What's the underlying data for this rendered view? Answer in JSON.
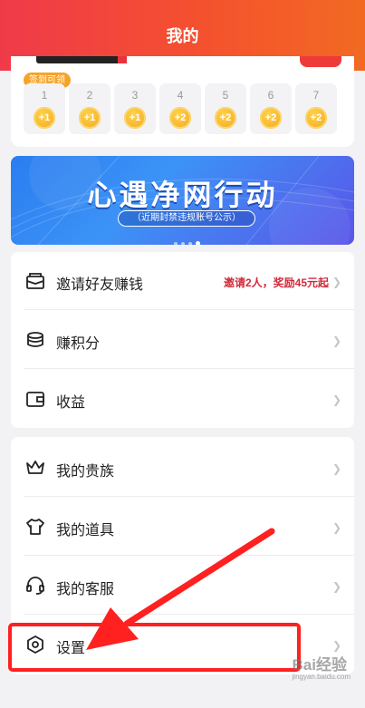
{
  "header": {
    "title": "我的"
  },
  "signin": {
    "badge": "签到可领",
    "days": [
      {
        "day": "1",
        "reward": "+1"
      },
      {
        "day": "2",
        "reward": "+1"
      },
      {
        "day": "3",
        "reward": "+1"
      },
      {
        "day": "4",
        "reward": "+2"
      },
      {
        "day": "5",
        "reward": "+2"
      },
      {
        "day": "6",
        "reward": "+2"
      },
      {
        "day": "7",
        "reward": "+2"
      }
    ]
  },
  "banner": {
    "headline": "心遇净网行动",
    "subtitle": "（近期封禁违规账号公示）",
    "page_count": 4,
    "active_page": 4
  },
  "menu_group1": {
    "invite": {
      "label": "邀请好友赚钱",
      "reward_text": "邀请2人，奖励45元起",
      "icon": "envelope-icon"
    },
    "points": {
      "label": "赚积分",
      "icon": "coins-icon"
    },
    "earnings": {
      "label": "收益",
      "icon": "wallet-icon"
    }
  },
  "menu_group2": {
    "noble": {
      "label": "我的贵族",
      "icon": "crown-icon"
    },
    "props": {
      "label": "我的道具",
      "icon": "tshirt-icon"
    },
    "service": {
      "label": "我的客服",
      "icon": "headset-icon"
    },
    "settings": {
      "label": "设置",
      "icon": "hexagon-settings-icon"
    }
  },
  "annotation": {
    "highlight_color": "#ff2020"
  },
  "watermark": {
    "text": "Bai经验",
    "sub": "jingyan.baidu.com"
  }
}
